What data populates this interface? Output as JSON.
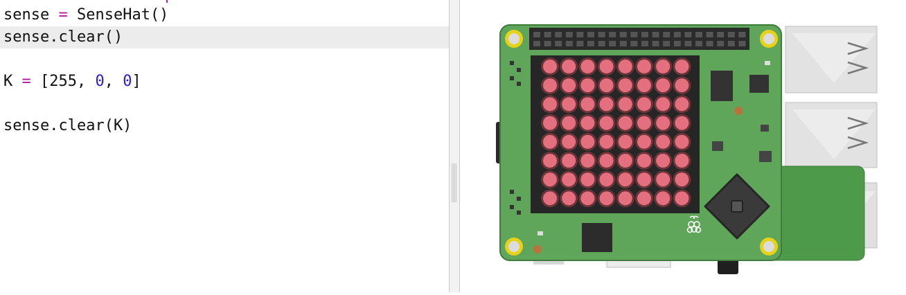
{
  "editor": {
    "lines": [
      {
        "tokens": [
          {
            "t": "sense "
          },
          {
            "t": "=",
            "c": "op"
          },
          {
            "t": " SenseHat()"
          }
        ]
      },
      {
        "tokens": [
          {
            "t": "sense.clear()"
          }
        ],
        "active": true
      },
      {
        "tokens": []
      },
      {
        "tokens": [
          {
            "t": "K "
          },
          {
            "t": "=",
            "c": "op"
          },
          {
            "t": " [255, "
          },
          {
            "t": "0",
            "c": "num"
          },
          {
            "t": ", "
          },
          {
            "t": "0",
            "c": "num"
          },
          {
            "t": "]"
          }
        ]
      },
      {
        "tokens": []
      },
      {
        "tokens": [
          {
            "t": "sense.clear(K)"
          }
        ]
      }
    ]
  },
  "emulator": {
    "led_matrix": {
      "rows": 8,
      "cols": 8,
      "color": "#e46f7e"
    },
    "board_color": "#5fa55a",
    "logo": "raspberry-pi-logo"
  },
  "colors": {
    "operator": "#b0179e",
    "number": "#2a1bd8",
    "active_line": "#ececec"
  }
}
